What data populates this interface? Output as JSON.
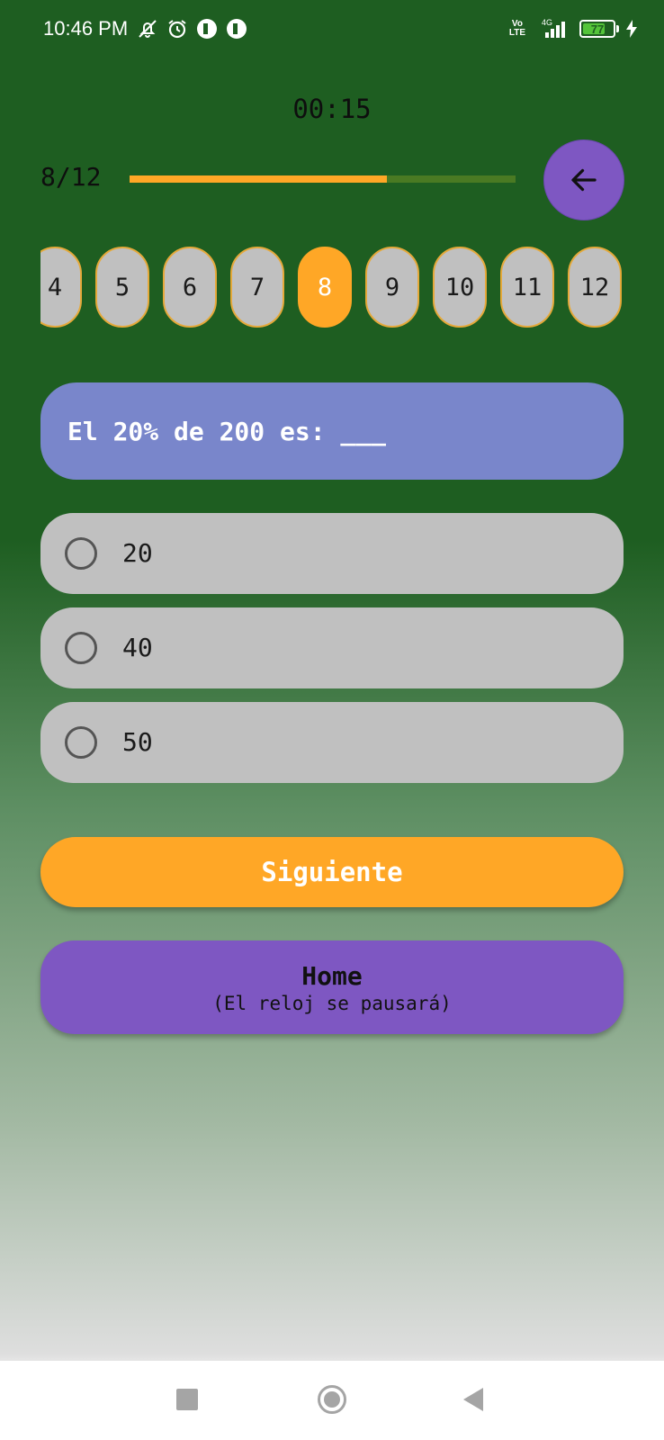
{
  "status_bar": {
    "time": "10:46 PM",
    "icons_left": [
      "mute-icon",
      "alarm-icon",
      "app-notification-icon",
      "app-notification-icon"
    ],
    "network": {
      "volte_line1": "Vo",
      "volte_line2": "LTE",
      "generation": "4G"
    },
    "battery_level": "77",
    "charging": true
  },
  "quiz": {
    "timer": "00:15",
    "progress_label": "8/12",
    "progress_fraction": 0.667,
    "back_button_icon": "arrow-left-icon",
    "question_numbers": [
      "4",
      "5",
      "6",
      "7",
      "8",
      "9",
      "10",
      "11",
      "12"
    ],
    "current_question": "8",
    "question_text": "El 20% de 200 es: ___",
    "options": [
      {
        "label": "20",
        "selected": false
      },
      {
        "label": "40",
        "selected": false
      },
      {
        "label": "50",
        "selected": false
      }
    ],
    "next_button": "Siguiente",
    "home_button": {
      "title": "Home",
      "subtitle": "(El reloj se pausará)"
    }
  },
  "colors": {
    "accent_orange": "#ffa726",
    "accent_purple": "#7e57c2",
    "question_card": "#7986cb",
    "background_green": "#1e5e21"
  },
  "nav_bar": {
    "icons": [
      "recent-apps-icon",
      "home-circle-icon",
      "back-triangle-icon"
    ]
  }
}
